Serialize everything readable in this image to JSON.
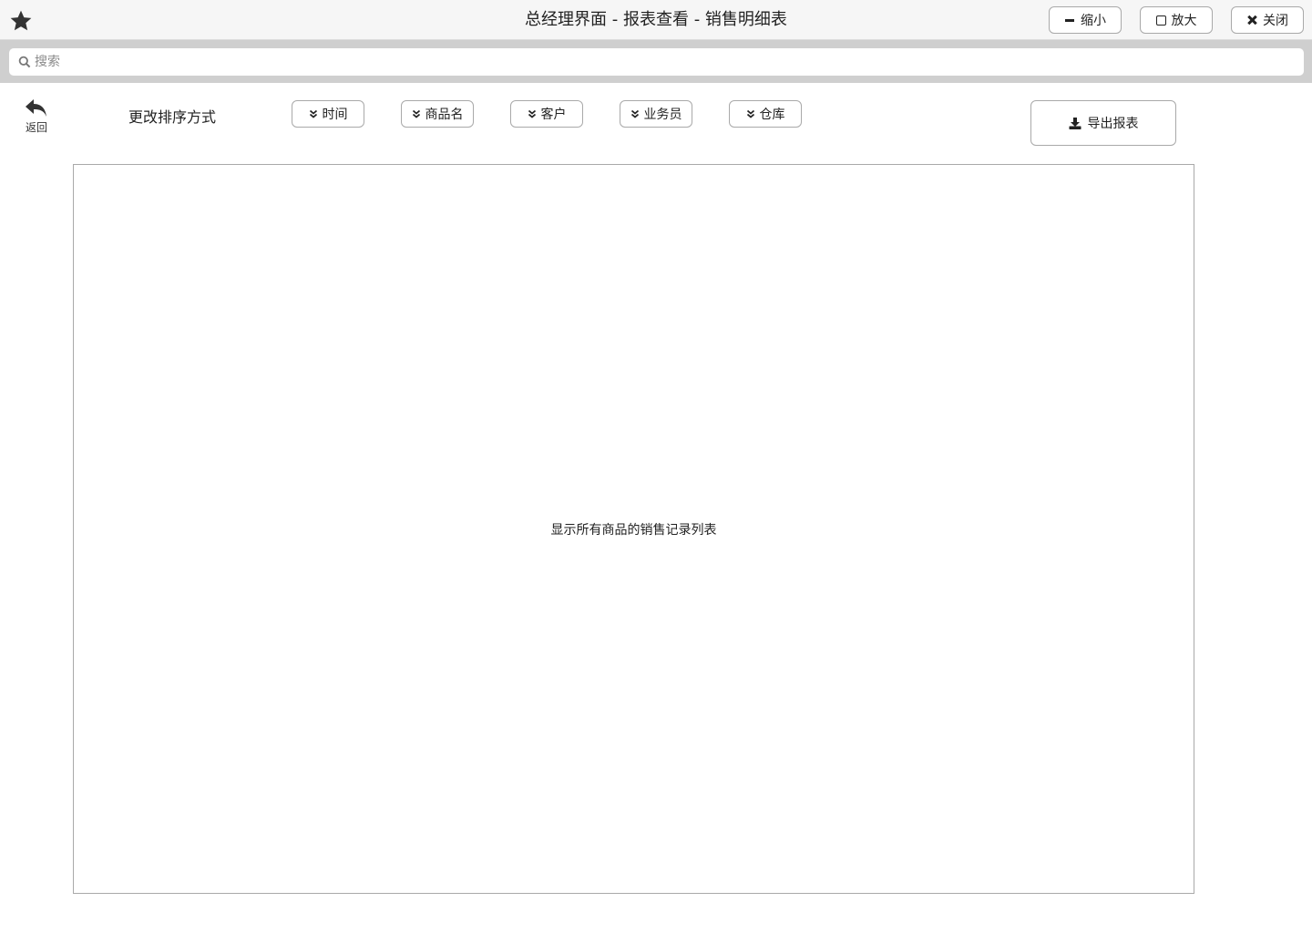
{
  "window": {
    "title": "总经理界面 - 报表查看 - 销售明细表",
    "favorite_icon": "star-icon",
    "controls": {
      "minimize_label": "缩小",
      "maximize_label": "放大",
      "close_label": "关闭"
    }
  },
  "search": {
    "placeholder": "搜索",
    "value": "",
    "icon": "search-icon"
  },
  "toolbar": {
    "back_label": "返回",
    "back_icon": "reply-arrow-icon",
    "sort_label": "更改排序方式",
    "sort_options": [
      {
        "label": "时间",
        "icon": "double-chevron-down-icon"
      },
      {
        "label": "商品名",
        "icon": "double-chevron-down-icon"
      },
      {
        "label": "客户",
        "icon": "double-chevron-down-icon"
      },
      {
        "label": "业务员",
        "icon": "double-chevron-down-icon"
      },
      {
        "label": "仓库",
        "icon": "double-chevron-down-icon"
      }
    ],
    "export_label": "导出报表",
    "export_icon": "download-icon"
  },
  "main": {
    "list_placeholder": "显示所有商品的销售记录列表"
  },
  "colors": {
    "titlebar_bg": "#f6f6f6",
    "searchbar_bg": "#cfcfcf",
    "border": "#a9a9a9",
    "text": "#222222"
  }
}
